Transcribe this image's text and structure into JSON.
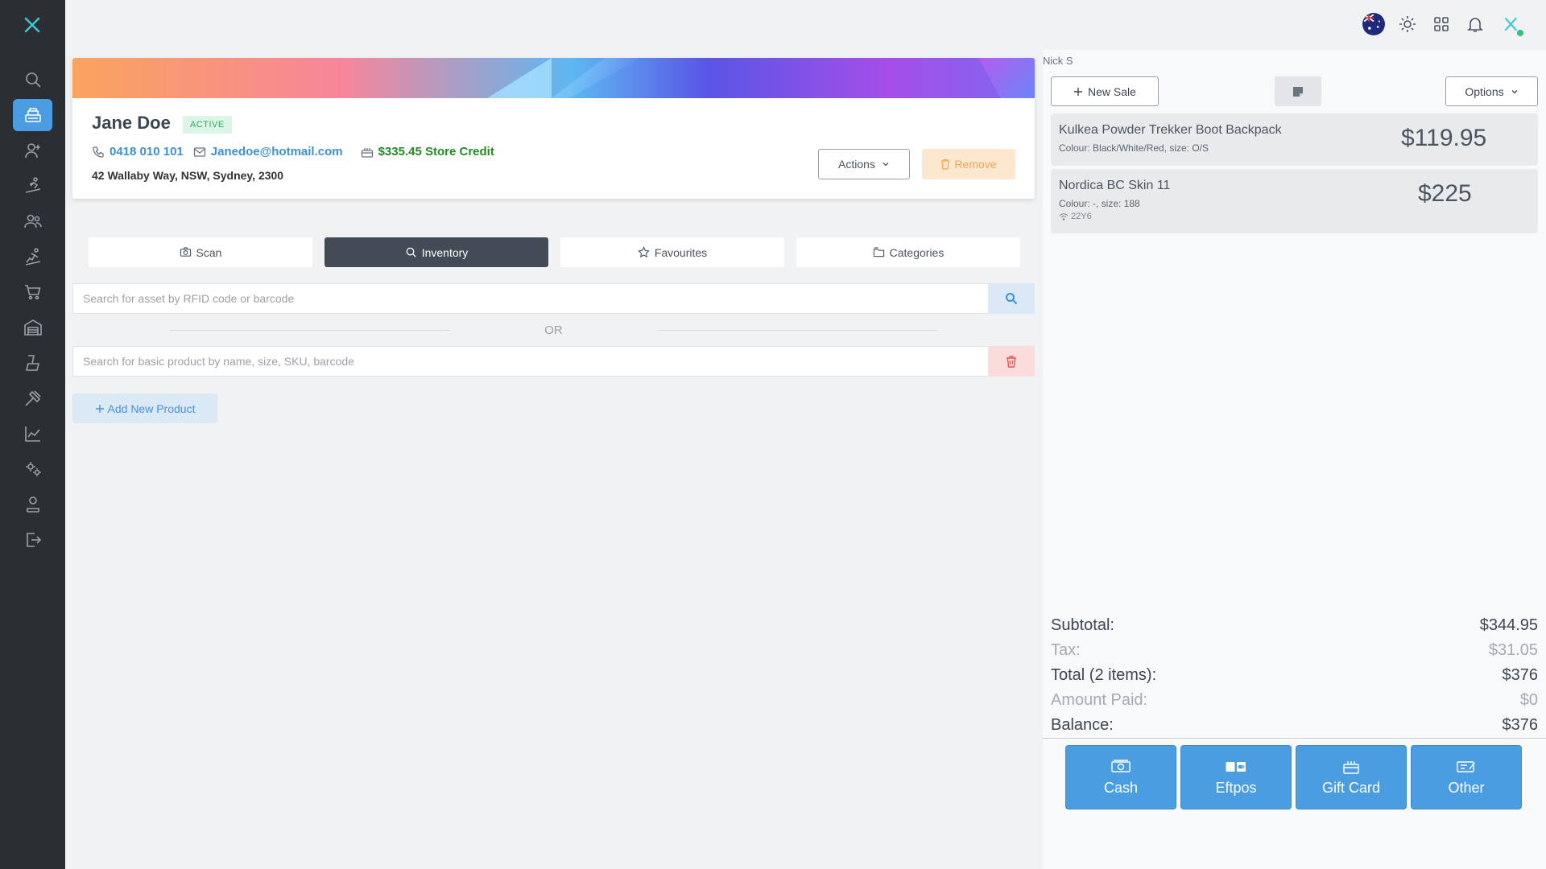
{
  "app": {
    "logo_icon": "close-x-logo",
    "sidebar_icons": [
      "search-icon",
      "register-icon",
      "add-customer-icon",
      "rental-icon",
      "customers-icon",
      "service-icon",
      "cart-icon",
      "warehouse-icon",
      "inventory-icon",
      "tools-icon",
      "reports-icon",
      "settings-icon",
      "staff-icon",
      "logout-icon"
    ],
    "sidebar_active": "register-icon",
    "accent": "#4a9de0"
  },
  "topbar": {
    "icons": [
      "australia-flag-icon",
      "sun-icon",
      "grid-icon",
      "bell-icon",
      "brand-icon"
    ]
  },
  "customer": {
    "name": "Jane Doe",
    "status": "ACTIVE",
    "phone": "0418 010 101",
    "email": "Janedoe@hotmail.com",
    "credit": "$335.45 Store Credit",
    "address": "42 Wallaby Way, NSW, Sydney, 2300",
    "actions_label": "Actions",
    "remove_label": "Remove"
  },
  "tabs": [
    {
      "label": "Scan",
      "icon": "camera-icon"
    },
    {
      "label": "Inventory",
      "icon": "search-icon",
      "active": true
    },
    {
      "label": "Favourites",
      "icon": "star-icon"
    },
    {
      "label": "Categories",
      "icon": "folder-icon"
    }
  ],
  "search": {
    "rfid_placeholder": "Search for asset by RFID code or barcode",
    "or_text": "OR",
    "product_placeholder": "Search for basic product by name, size, SKU, barcode",
    "add_product_label": "Add New Product"
  },
  "sale": {
    "staff": "Nick S",
    "new_sale_label": "New Sale",
    "options_label": "Options",
    "items": [
      {
        "name": "Kulkea Powder Trekker Boot Backpack",
        "desc": "Colour: Black/White/Red, size: O/S",
        "price": "$119.95",
        "tag": ""
      },
      {
        "name": "Nordica BC Skin 11",
        "desc": "Colour: -, size: 188",
        "price": "$225",
        "tag": "22Y6"
      }
    ],
    "totals": {
      "subtotal_label": "Subtotal:",
      "subtotal": "$344.95",
      "tax_label": "Tax:",
      "tax": "$31.05",
      "total_label": "Total (2 items):",
      "total": "$376",
      "paid_label": "Amount Paid:",
      "paid": "$0",
      "balance_label": "Balance:",
      "balance": "$376"
    },
    "payments": [
      {
        "label": "Cash",
        "icon": "cash-icon"
      },
      {
        "label": "Eftpos",
        "icon": "card-icon"
      },
      {
        "label": "Gift Card",
        "icon": "gift-icon"
      },
      {
        "label": "Other",
        "icon": "voucher-icon"
      }
    ]
  }
}
